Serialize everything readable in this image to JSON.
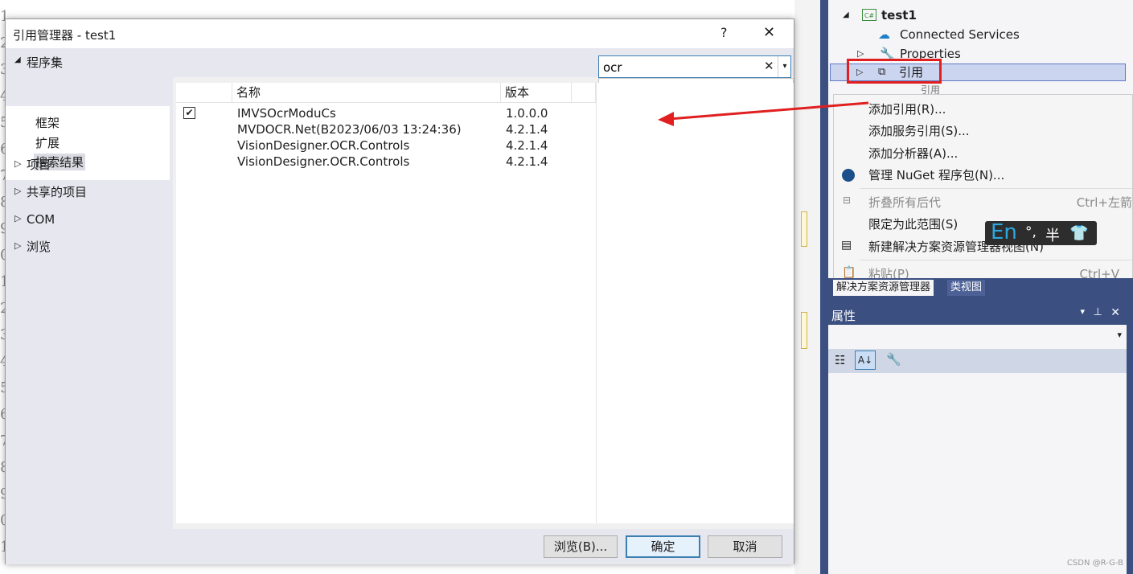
{
  "dialog": {
    "title": "引用管理器 - test1",
    "help_label": "?",
    "close_label": "✕",
    "left_panel": {
      "group_label": "程序集",
      "subcategories": [
        "框架",
        "扩展",
        "搜索结果"
      ],
      "selected_subcategory": "搜索结果",
      "categories": [
        "项目",
        "共享的项目",
        "COM",
        "浏览"
      ]
    },
    "search": {
      "value": "ocr",
      "clear_label": "✕",
      "suggestion": "ocr"
    },
    "grid": {
      "columns": [
        "名称",
        "版本"
      ],
      "rows": [
        {
          "checked": true,
          "name": "IMVSOcrModuCs",
          "version": "1.0.0.0"
        },
        {
          "checked": false,
          "name": "MVDOCR.Net(B2023/06/03 13:24:36)",
          "version": "4.2.1.4"
        },
        {
          "checked": false,
          "name": "VisionDesigner.OCR.Controls",
          "version": "4.2.1.4"
        },
        {
          "checked": false,
          "name": "VisionDesigner.OCR.Controls",
          "version": "4.2.1.4"
        }
      ]
    },
    "buttons": {
      "browse": "浏览(B)...",
      "ok": "确定",
      "cancel": "取消"
    }
  },
  "solution_explorer": {
    "project": "test1",
    "project_badge": "C#",
    "items": [
      "Connected Services",
      "Properties",
      "引用"
    ],
    "hidden_child": "引用",
    "tabs": [
      "解决方案资源管理器",
      "类视图"
    ]
  },
  "context_menu": {
    "items": [
      {
        "label": "添加引用(R)...",
        "shortcut": "",
        "disabled": false
      },
      {
        "label": "添加服务引用(S)...",
        "shortcut": "",
        "disabled": false
      },
      {
        "label": "添加分析器(A)...",
        "shortcut": "",
        "disabled": false
      },
      {
        "label": "管理 NuGet 程序包(N)...",
        "shortcut": "",
        "disabled": false
      },
      {
        "label": "折叠所有后代",
        "shortcut": "Ctrl+左箭",
        "disabled": true
      },
      {
        "label": "限定为此范围(S)",
        "shortcut": "",
        "disabled": false
      },
      {
        "label": "新建解决方案资源管理器视图(N)",
        "shortcut": "",
        "disabled": false
      },
      {
        "label": "粘贴(P)",
        "shortcut": "Ctrl+V",
        "disabled": true
      }
    ]
  },
  "ime": {
    "mode": "En",
    "punct": "°,",
    "width": "半"
  },
  "properties": {
    "title": "属性",
    "dropdown": "▾"
  },
  "editor": {
    "gutter": [
      "1",
      "2",
      "3",
      "4",
      "5",
      "6",
      "7",
      "8",
      "9",
      "0",
      "1",
      "2",
      "3",
      "4",
      "5",
      "6",
      "7",
      "8",
      "9",
      "0",
      "1"
    ]
  },
  "colors": {
    "accent": "#3b4f81",
    "highlight_red": "#e02020",
    "selected": "#ccd5f0"
  },
  "watermark": "CSDN @R-G-B"
}
